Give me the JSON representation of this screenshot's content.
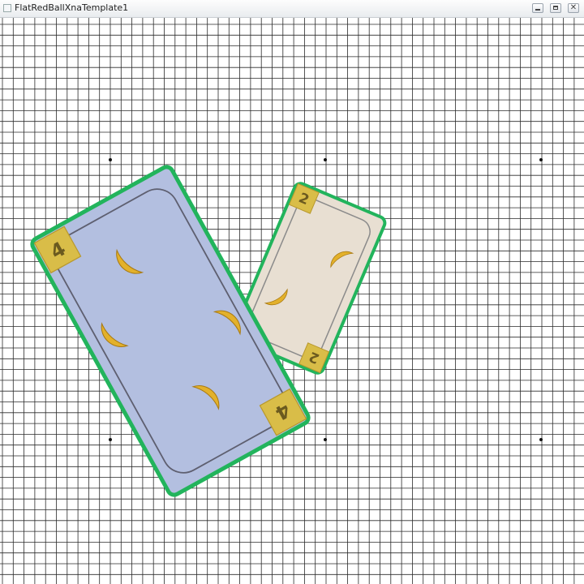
{
  "window": {
    "title": "FlatRedBallXnaTemplate1"
  },
  "scene": {
    "background": "#ffffff",
    "grid_color": "#2a2a2a",
    "card_border_color": "#22b45c",
    "cards": [
      {
        "name": "card-blue",
        "rank_label": "4",
        "face_color": "#b3bfe0",
        "banana_count": 4
      },
      {
        "name": "card-cream",
        "rank_label": "2",
        "face_color": "#e8dfd2",
        "banana_count": 2
      }
    ]
  }
}
